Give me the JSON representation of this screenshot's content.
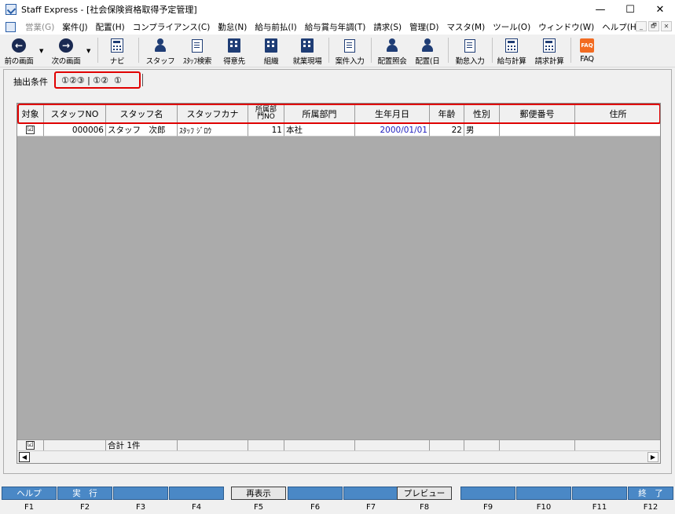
{
  "window": {
    "title": "Staff Express - [社会保険資格取得予定管理]",
    "controls": [
      "—",
      "☐",
      "✕"
    ]
  },
  "menu": {
    "items": [
      {
        "label": "営業(G)",
        "disabled": true
      },
      {
        "label": "案件(J)",
        "disabled": false
      },
      {
        "label": "配置(H)",
        "disabled": false
      },
      {
        "label": "コンプライアンス(C)",
        "disabled": false
      },
      {
        "label": "勤怠(N)",
        "disabled": false
      },
      {
        "label": "給与前払(I)",
        "disabled": false
      },
      {
        "label": "給与賞与年調(T)",
        "disabled": false
      },
      {
        "label": "請求(S)",
        "disabled": false
      },
      {
        "label": "管理(D)",
        "disabled": false
      },
      {
        "label": "マスタ(M)",
        "disabled": false
      },
      {
        "label": "ツール(O)",
        "disabled": false
      },
      {
        "label": "ウィンドウ(W)",
        "disabled": false
      },
      {
        "label": "ヘルプ(H)",
        "disabled": false
      }
    ],
    "mdi": [
      "_",
      "🗗",
      "✕"
    ]
  },
  "toolbar": {
    "prev": "前の画面",
    "next": "次の画面",
    "navi": "ナビ",
    "staff": "スタッフ",
    "staff_search": "ｽﾀｯﾌ検索",
    "client": "得意先",
    "org": "組織",
    "site": "就業現場",
    "case_input": "案件入力",
    "assign_query": "配置照会",
    "assign_day": "配置(日",
    "attendance_input": "勤怠入力",
    "payroll_calc": "給与計算",
    "billing_calc": "請求計算",
    "faq": "FAQ"
  },
  "conditions": {
    "label": "抽出条件",
    "value": "①②③ | ①②  ①"
  },
  "grid": {
    "headers": [
      "対象",
      "スタッフNO",
      "スタッフ名",
      "スタッフカナ",
      "所属部\n門NO",
      "所属部門",
      "生年月日",
      "年齢",
      "性別",
      "郵便番号",
      "住所"
    ],
    "rows": [
      {
        "checked": "☑",
        "staff_no": "000006",
        "staff_name": "スタッフ　次郎",
        "kana": "ｽﾀｯﾌ ｼﾞﾛｳ",
        "dept_no": "11",
        "dept": "本社",
        "birth": "2000/01/01",
        "age": "22",
        "gender": "男",
        "zip": "",
        "address": ""
      }
    ],
    "footer": {
      "checked": "☑",
      "total": "合計 1件"
    }
  },
  "fkeys": [
    {
      "label": "ヘルプ",
      "key": "F1"
    },
    {
      "label": "実　行",
      "key": "F2"
    },
    {
      "label": "",
      "key": "F3"
    },
    {
      "label": "",
      "key": "F4"
    },
    {
      "label": "再表示",
      "key": "F5"
    },
    {
      "label": "",
      "key": "F6"
    },
    {
      "label": "",
      "key": "F7"
    },
    {
      "label": "プレビュー",
      "key": "F8"
    },
    {
      "label": "",
      "key": "F9"
    },
    {
      "label": "",
      "key": "F10"
    },
    {
      "label": "",
      "key": "F11"
    },
    {
      "label": "終　了",
      "key": "F12"
    }
  ]
}
